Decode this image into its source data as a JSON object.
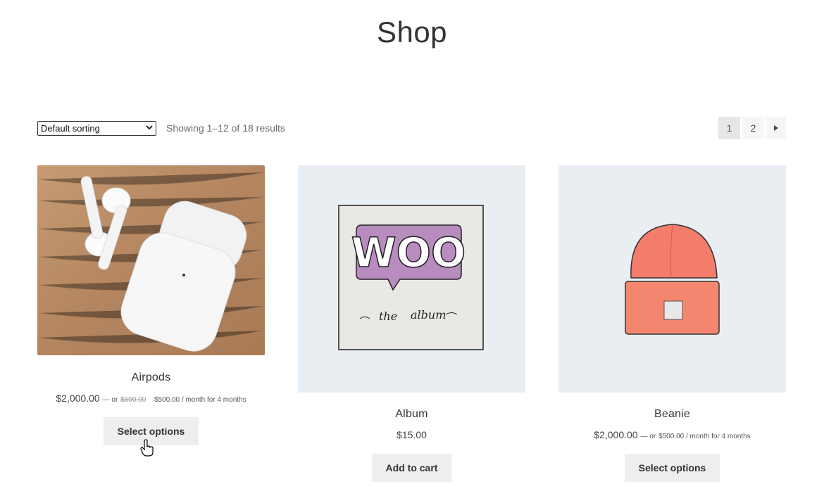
{
  "page": {
    "title": "Shop"
  },
  "toolbar": {
    "sort_selected": "Default sorting",
    "result_count": "Showing 1–12 of 18 results"
  },
  "pagination": {
    "pages": [
      "1",
      "2"
    ],
    "current": "1",
    "next_icon": "triangle-right-icon"
  },
  "products": [
    {
      "title": "Airpods",
      "price": "$2,000.00",
      "price_sep": "— or",
      "price_strike": "$600.00",
      "price_monthly": "$500.00 / month for 4 months",
      "button": "Select options",
      "image": "airpods-photo"
    },
    {
      "title": "Album",
      "price": "$15.00",
      "button": "Add to cart",
      "image": "woo-album-illustration",
      "album_logo": "WOO",
      "album_caption_1": "the",
      "album_caption_2": "album"
    },
    {
      "title": "Beanie",
      "price": "$2,000.00",
      "price_sep": "— or",
      "price_monthly": "$500.00 / month for 4 months",
      "button": "Select options",
      "image": "beanie-illustration"
    }
  ],
  "colors": {
    "button_bg": "#eeeeee",
    "thumb_bg": "#e9eef2",
    "beanie": "#f47c6a",
    "woo_purple": "#b98cc0"
  }
}
